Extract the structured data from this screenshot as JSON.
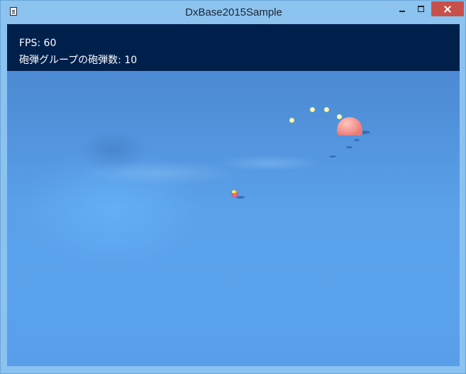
{
  "window": {
    "title": "DxBase2015Sample"
  },
  "hud": {
    "fps_label": "FPS: 60",
    "shell_count_label": "砲弾グループの砲弾数: 10"
  },
  "colors": {
    "titlebar": "#8cc3ef",
    "close_button": "#c7504a",
    "hud_background": "#00204c",
    "sky": "#5aa1ea",
    "dome": "#f2938d",
    "shell": "#f2f08a"
  },
  "icons": {
    "app": "document-icon",
    "minimize": "minimize-icon",
    "maximize": "maximize-icon",
    "close": "close-icon"
  }
}
